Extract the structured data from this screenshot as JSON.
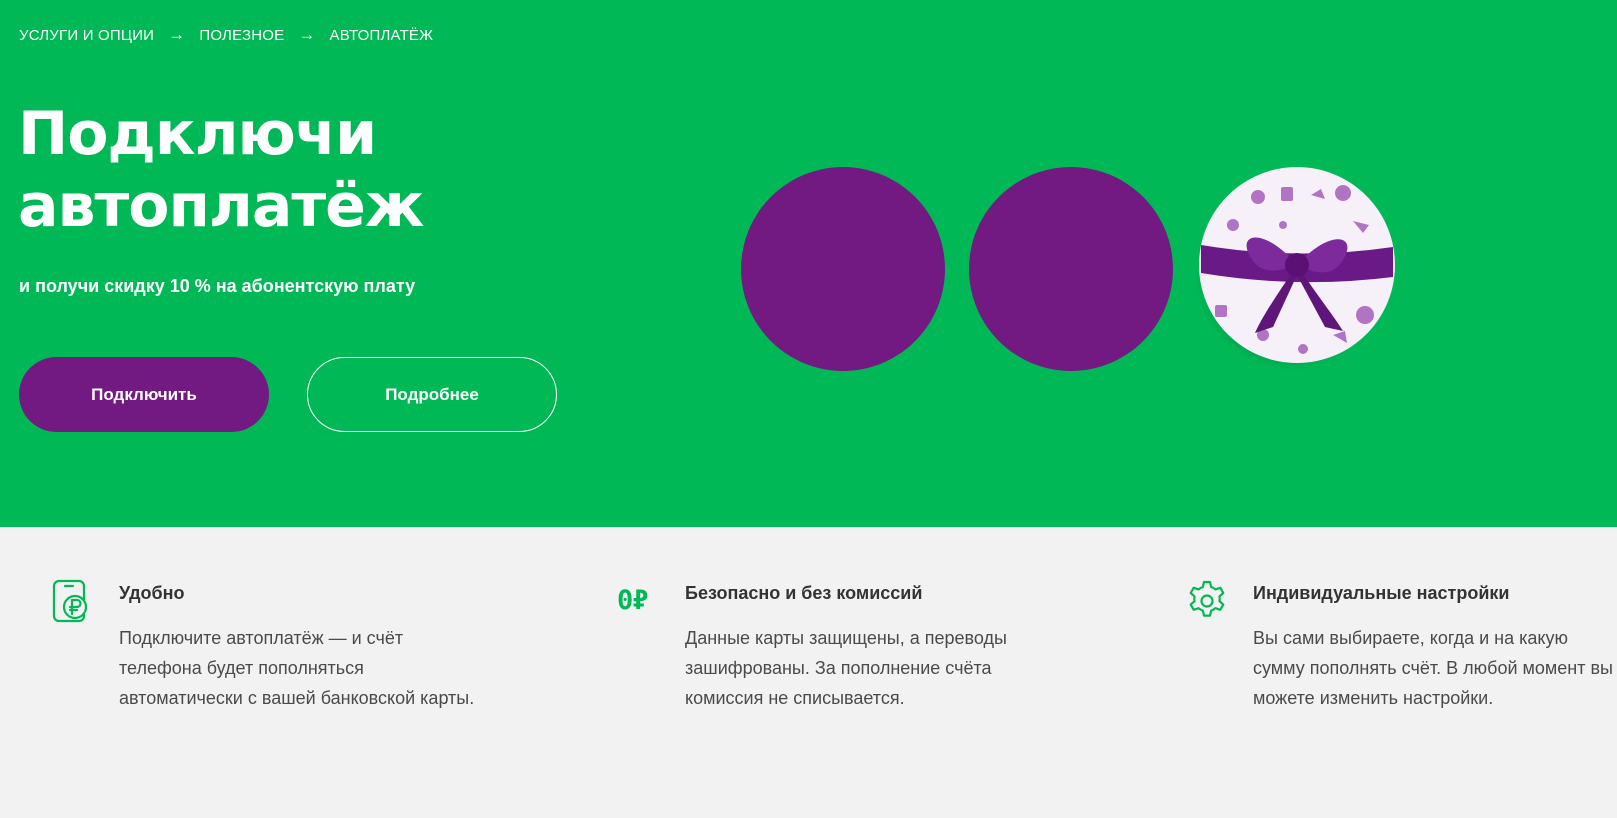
{
  "breadcrumb": {
    "items": [
      "Услуги и опции",
      "Полезное",
      "Автоплатёж"
    ],
    "separator": "→"
  },
  "hero": {
    "title_line1": "Подключи",
    "title_line2": "автоплатёж",
    "subtitle": "и получи скидку 10 % на абонентскую плату",
    "primary_button": "Подключить",
    "secondary_button": "Подробнее"
  },
  "features": [
    {
      "title": "Удобно",
      "text": "Подключите автоплатёж — и счёт телефона будет пополняться автоматически с вашей банковской карты.",
      "icon": "phone-ruble-icon"
    },
    {
      "title": "Безопасно и без комиссий",
      "text": "Данные карты защищены, а переводы зашифрованы. За пополнение счёта комиссия не списывается.",
      "icon": "zero-ruble-icon",
      "icon_text": "0₽"
    },
    {
      "title": "Индивидуальные настройки",
      "text": "Вы сами выбираете, когда и на какую сумму пополнять счёт. В любой момент вы можете изменить настройки.",
      "icon": "gear-icon"
    }
  ],
  "colors": {
    "brand_green": "#00b956",
    "brand_purple": "#731982",
    "background_light": "#f2f2f2"
  }
}
